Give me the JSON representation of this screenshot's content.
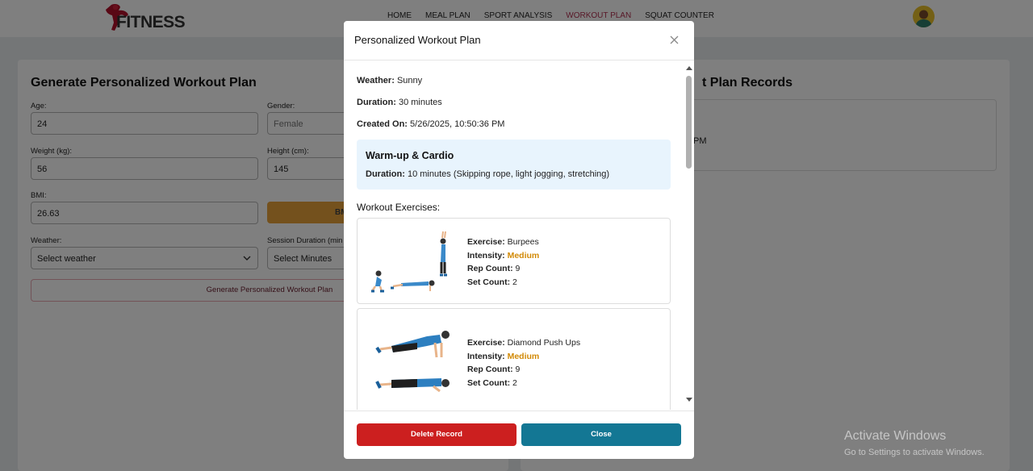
{
  "nav": {
    "logo_text": "FITNESS",
    "links": [
      "HOME",
      "MEAL PLAN",
      "SPORT ANALYSIS",
      "WORKOUT PLAN",
      "SQUAT COUNTER"
    ],
    "active": "WORKOUT PLAN"
  },
  "form": {
    "title": "Generate Personalized Workout Plan",
    "age_label": "Age:",
    "age_value": "24",
    "gender_label": "Gender:",
    "gender_value": "Female",
    "weight_label": "Weight (kg):",
    "weight_value": "56",
    "height_label": "Height (cm):",
    "height_value": "145",
    "bmi_label": "BMI:",
    "bmi_value": "26.63",
    "bmi_button": "BM",
    "weather_label": "Weather:",
    "weather_placeholder": "Select weather",
    "session_label": "Session Duration (min",
    "session_placeholder": "Select Minutes",
    "generate_button": "Generate Personalized Workout Plan"
  },
  "records": {
    "title_fragment": "t Plan Records",
    "entry_fragment": "PM"
  },
  "modal": {
    "title": "Personalized Workout Plan",
    "weather_label": "Weather:",
    "weather_value": "Sunny",
    "duration_label": "Duration:",
    "duration_value": "30 minutes",
    "created_label": "Created On:",
    "created_value": "5/26/2025, 10:50:36 PM",
    "warmup": {
      "title": "Warm-up & Cardio",
      "duration_label": "Duration:",
      "duration_value": "10 minutes (Skipping rope, light jogging, stretching)"
    },
    "exercises_title": "Workout Exercises:",
    "exercise_label": "Exercise:",
    "intensity_label": "Intensity:",
    "rep_label": "Rep Count:",
    "set_label": "Set Count:",
    "exercises": [
      {
        "name": "Burpees",
        "intensity": "Medium",
        "reps": "9",
        "sets": "2"
      },
      {
        "name": "Diamond Push Ups",
        "intensity": "Medium",
        "reps": "9",
        "sets": "2"
      }
    ],
    "delete_button": "Delete Record",
    "close_button": "Close"
  },
  "watermark": {
    "line1": "Activate Windows",
    "line2": "Go to Settings to activate Windows."
  },
  "colors": {
    "accent_active": "#b03050",
    "intensity": "#d28a07",
    "delete": "#cc1f1f",
    "close": "#137794",
    "warmup_bg": "#e8f4fd"
  }
}
